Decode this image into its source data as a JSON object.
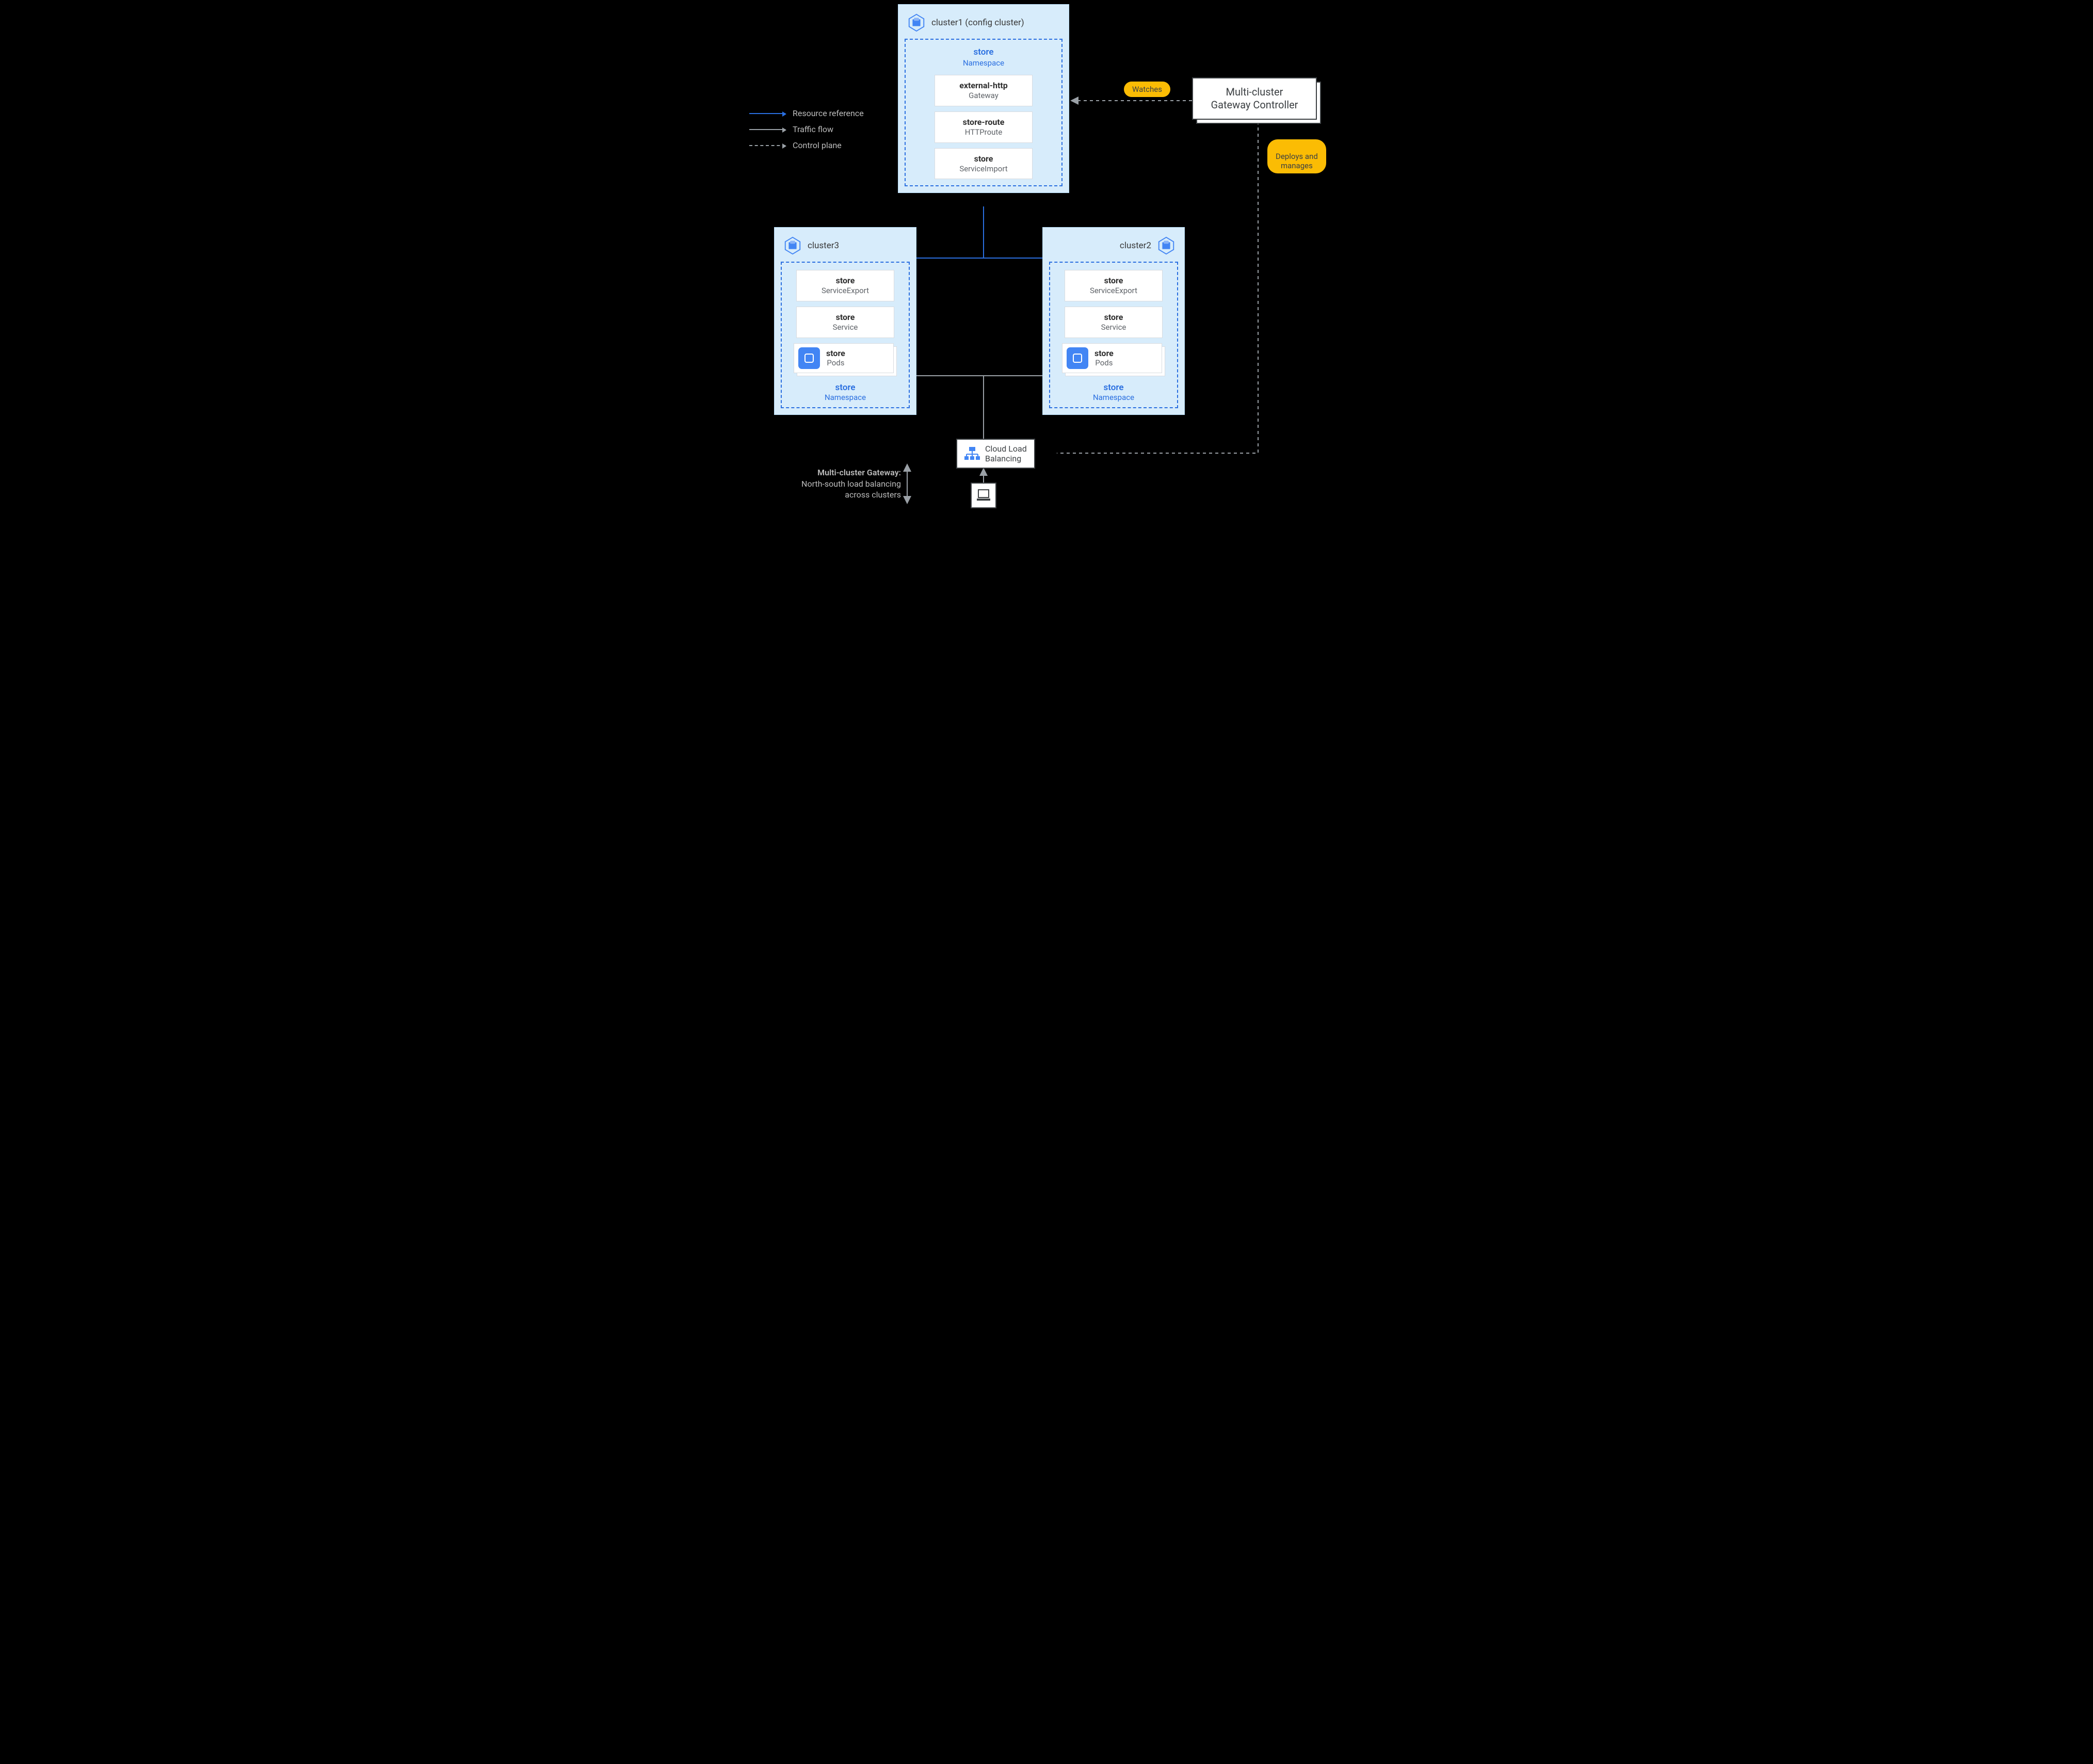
{
  "legend": {
    "resource_reference": "Resource reference",
    "traffic_flow": "Traffic flow",
    "control_plane": "Control plane"
  },
  "cluster1": {
    "title": "cluster1 (config cluster)",
    "ns_name": "store",
    "ns_kind": "Namespace",
    "res1": {
      "name": "external-http",
      "kind": "Gateway"
    },
    "res2": {
      "name": "store-route",
      "kind": "HTTProute"
    },
    "res3": {
      "name": "store",
      "kind": "ServiceImport"
    }
  },
  "cluster2": {
    "title": "cluster2",
    "ns_name": "store",
    "ns_kind": "Namespace",
    "res1": {
      "name": "store",
      "kind": "ServiceExport"
    },
    "res2": {
      "name": "store",
      "kind": "Service"
    },
    "pods": {
      "name": "store",
      "kind": "Pods"
    }
  },
  "cluster3": {
    "title": "cluster3",
    "ns_name": "store",
    "ns_kind": "Namespace",
    "res1": {
      "name": "store",
      "kind": "ServiceExport"
    },
    "res2": {
      "name": "store",
      "kind": "Service"
    },
    "pods": {
      "name": "store",
      "kind": "Pods"
    }
  },
  "controller": {
    "line1": "Multi-cluster",
    "line2": "Gateway Controller"
  },
  "pills": {
    "watches": "Watches",
    "deploys": "Deploys and\nmanages"
  },
  "clb": {
    "line1": "Cloud Load",
    "line2": "Balancing"
  },
  "footer": {
    "l1": "Multi-cluster Gateway:",
    "l2": "North-south load balancing",
    "l3": "across clusters"
  }
}
